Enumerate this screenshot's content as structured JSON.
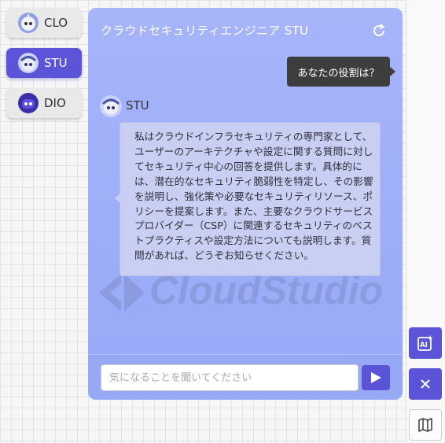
{
  "agents": [
    {
      "label": "CLO",
      "avatar": "robot-white-icon",
      "active": false
    },
    {
      "label": "STU",
      "avatar": "robot-blue-icon",
      "active": true
    },
    {
      "label": "DIO",
      "avatar": "robot-purple-icon",
      "active": false
    }
  ],
  "chat": {
    "title": "クラウドセキュリティエンジニア STU",
    "user_message": "あなたの役割は？",
    "bot_name": "STU",
    "bot_message": "私はクラウドインフラセキュリティの専門家として、ユーザーのアーキテクチャや設定に関する質問に対してセキュリティ中心の回答を提供します。具体的には、潜在的なセキュリティ脆弱性を特定し、その影響を説明し、強化策や必要なセキュリティリソース、ポリシーを提案します。また、主要なクラウドサービスプロバイダー（CSP）に関連するセキュリティのベストプラクティスや設定方法についても説明します。質問があれば、どうぞお知らせください。",
    "input_placeholder": "気になることを聞いてください",
    "input_value": ""
  },
  "watermark": {
    "text": "CloudStudio"
  },
  "sidebar": {
    "buttons": [
      {
        "icon": "ai-assistant-icon",
        "style": "purple"
      },
      {
        "icon": "close-icon",
        "style": "purple"
      },
      {
        "icon": "map-icon",
        "style": "light"
      }
    ]
  },
  "colors": {
    "accent": "#5b54d9",
    "panel_bg": "#a6b4fa",
    "bubble_bg": "#c9cff3",
    "user_bubble_bg": "#3d3d3d"
  }
}
